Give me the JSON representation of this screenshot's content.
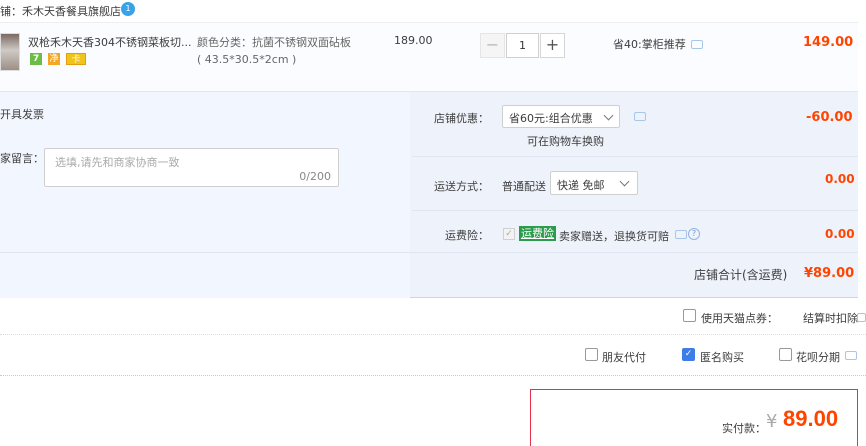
{
  "shop": {
    "label": "铺：禾木天香餐具旗舰店",
    "ww_badge": "1"
  },
  "item": {
    "title": "双枪禾木天香304不锈钢菜板切...",
    "badges": [
      "7",
      "净",
      "卡"
    ],
    "spec_line1": "颜色分类：抗菌不锈钢双面砧板",
    "spec_line2": "( 43.5*30.5*2cm )",
    "unit_price": "189.00",
    "qty": {
      "minus": "−",
      "value": "1",
      "plus": "+"
    },
    "promo": "省40:掌柜推荐",
    "total": "149.00"
  },
  "options": {
    "invoice_label": "开具发票",
    "message": {
      "label": "家留言：",
      "placeholder": "选填,请先和商家协商一致",
      "count": "0/200"
    },
    "coupon": {
      "label": "店铺优惠：",
      "value": "省60元:组合优惠",
      "note": "可在购物车换购",
      "amount": "-60.00"
    },
    "shipping": {
      "label": "运送方式：",
      "type": "普通配送",
      "value": "快递 免邮",
      "amount": "0.00"
    },
    "insurance": {
      "label": "运费险：",
      "check": "✓",
      "tag": "运费险",
      "desc": "卖家赠送，退换货可赔",
      "help": "?",
      "amount": "0.00"
    },
    "subtotal": {
      "label": "店铺合计(含运费)",
      "amount": "¥89.00"
    }
  },
  "points": {
    "label": "使用天猫点券：",
    "note": "结算时扣除"
  },
  "extras": {
    "friend_pay": "朋友代付",
    "anonymous": "匿名购买",
    "anon_check": "✓",
    "huabei": "花呗分期"
  },
  "payment": {
    "label": "实付款：",
    "symbol": "¥",
    "amount": "89.00"
  },
  "colors": {
    "price": "#ff4400",
    "accent_blue": "#3d7de8",
    "panel_bg": "#eef3fb",
    "insurance_green": "#2d9b4d",
    "pay_border": "#e9304a"
  }
}
